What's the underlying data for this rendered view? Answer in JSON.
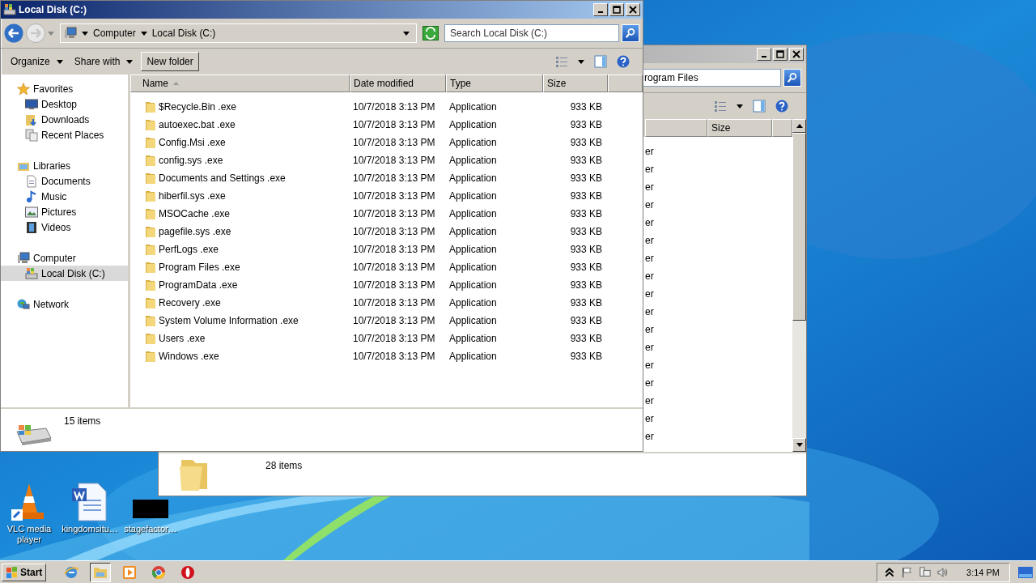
{
  "front_window": {
    "title": "Local Disk (C:)",
    "breadcrumb": [
      "Computer",
      "Local Disk (C:)"
    ],
    "search": {
      "placeholder": "Search Local Disk (C:)"
    },
    "toolbar": [
      {
        "label": "Organize",
        "kind": "menu"
      },
      {
        "label": "Share with",
        "kind": "menu"
      },
      {
        "label": "New folder",
        "kind": "button"
      }
    ],
    "sidebar": [
      {
        "label": "Favorites",
        "kind": "star",
        "selected": false,
        "children": [
          {
            "label": "Desktop",
            "kind": "desktop",
            "selected": false
          },
          {
            "label": "Downloads",
            "kind": "downloads",
            "selected": false
          },
          {
            "label": "Recent Places",
            "kind": "recent",
            "selected": false
          }
        ]
      },
      {
        "label": "Libraries",
        "kind": "library",
        "selected": false,
        "children": [
          {
            "label": "Documents",
            "kind": "document",
            "selected": false
          },
          {
            "label": "Music",
            "kind": "music",
            "selected": false
          },
          {
            "label": "Pictures",
            "kind": "pictures",
            "selected": false
          },
          {
            "label": "Videos",
            "kind": "videos",
            "selected": false
          }
        ]
      },
      {
        "label": "Computer",
        "kind": "computer",
        "selected": false,
        "children": [
          {
            "label": "Local Disk (C:)",
            "kind": "disk",
            "selected": true
          }
        ]
      },
      {
        "label": "Network",
        "kind": "network",
        "selected": false
      }
    ],
    "columns": [
      {
        "label": "Name",
        "sorted": true
      },
      {
        "label": "Date modified",
        "sorted": false
      },
      {
        "label": "Type",
        "sorted": false
      },
      {
        "label": "Size",
        "sorted": false
      }
    ],
    "rows": [
      {
        "name": "$Recycle.Bin .exe",
        "date": "10/7/2018 3:13 PM",
        "type": "Application",
        "size": "933 KB"
      },
      {
        "name": "autoexec.bat .exe",
        "date": "10/7/2018 3:13 PM",
        "type": "Application",
        "size": "933 KB"
      },
      {
        "name": "Config.Msi .exe",
        "date": "10/7/2018 3:13 PM",
        "type": "Application",
        "size": "933 KB"
      },
      {
        "name": "config.sys .exe",
        "date": "10/7/2018 3:13 PM",
        "type": "Application",
        "size": "933 KB"
      },
      {
        "name": "Documents and Settings .exe",
        "date": "10/7/2018 3:13 PM",
        "type": "Application",
        "size": "933 KB"
      },
      {
        "name": "hiberfil.sys .exe",
        "date": "10/7/2018 3:13 PM",
        "type": "Application",
        "size": "933 KB"
      },
      {
        "name": "MSOCache .exe",
        "date": "10/7/2018 3:13 PM",
        "type": "Application",
        "size": "933 KB"
      },
      {
        "name": "pagefile.sys .exe",
        "date": "10/7/2018 3:13 PM",
        "type": "Application",
        "size": "933 KB"
      },
      {
        "name": "PerfLogs .exe",
        "date": "10/7/2018 3:13 PM",
        "type": "Application",
        "size": "933 KB"
      },
      {
        "name": "Program Files .exe",
        "date": "10/7/2018 3:13 PM",
        "type": "Application",
        "size": "933 KB"
      },
      {
        "name": "ProgramData .exe",
        "date": "10/7/2018 3:13 PM",
        "type": "Application",
        "size": "933 KB"
      },
      {
        "name": "Recovery .exe",
        "date": "10/7/2018 3:13 PM",
        "type": "Application",
        "size": "933 KB"
      },
      {
        "name": "System Volume Information .exe",
        "date": "10/7/2018 3:13 PM",
        "type": "Application",
        "size": "933 KB"
      },
      {
        "name": "Users .exe",
        "date": "10/7/2018 3:13 PM",
        "type": "Application",
        "size": "933 KB"
      },
      {
        "name": "Windows .exe",
        "date": "10/7/2018 3:13 PM",
        "type": "Application",
        "size": "933 KB"
      }
    ],
    "status": "15 items"
  },
  "back_window": {
    "search": {
      "value": "rogram Files"
    },
    "columns": [
      {
        "label": "Size"
      }
    ],
    "rows": [
      "er",
      "er",
      "er",
      "er",
      "er",
      "er",
      "er",
      "er",
      "er",
      "er",
      "er",
      "er",
      "er",
      "er",
      "er",
      "er",
      "er"
    ],
    "status": "28 items"
  },
  "desktop_icons": [
    {
      "label": "VLC media player",
      "kind": "cone"
    },
    {
      "label": "kingdomsitu…",
      "kind": "document"
    },
    {
      "label": "stagefactor…",
      "kind": "blank"
    }
  ],
  "taskbar": {
    "start": "Start",
    "apps": [
      {
        "kind": "globe",
        "selected": false
      },
      {
        "kind": "folder",
        "selected": true
      },
      {
        "kind": "play",
        "selected": false
      },
      {
        "kind": "chrome",
        "selected": false
      },
      {
        "kind": "ring",
        "selected": false
      }
    ],
    "clock": "3:14 PM"
  }
}
